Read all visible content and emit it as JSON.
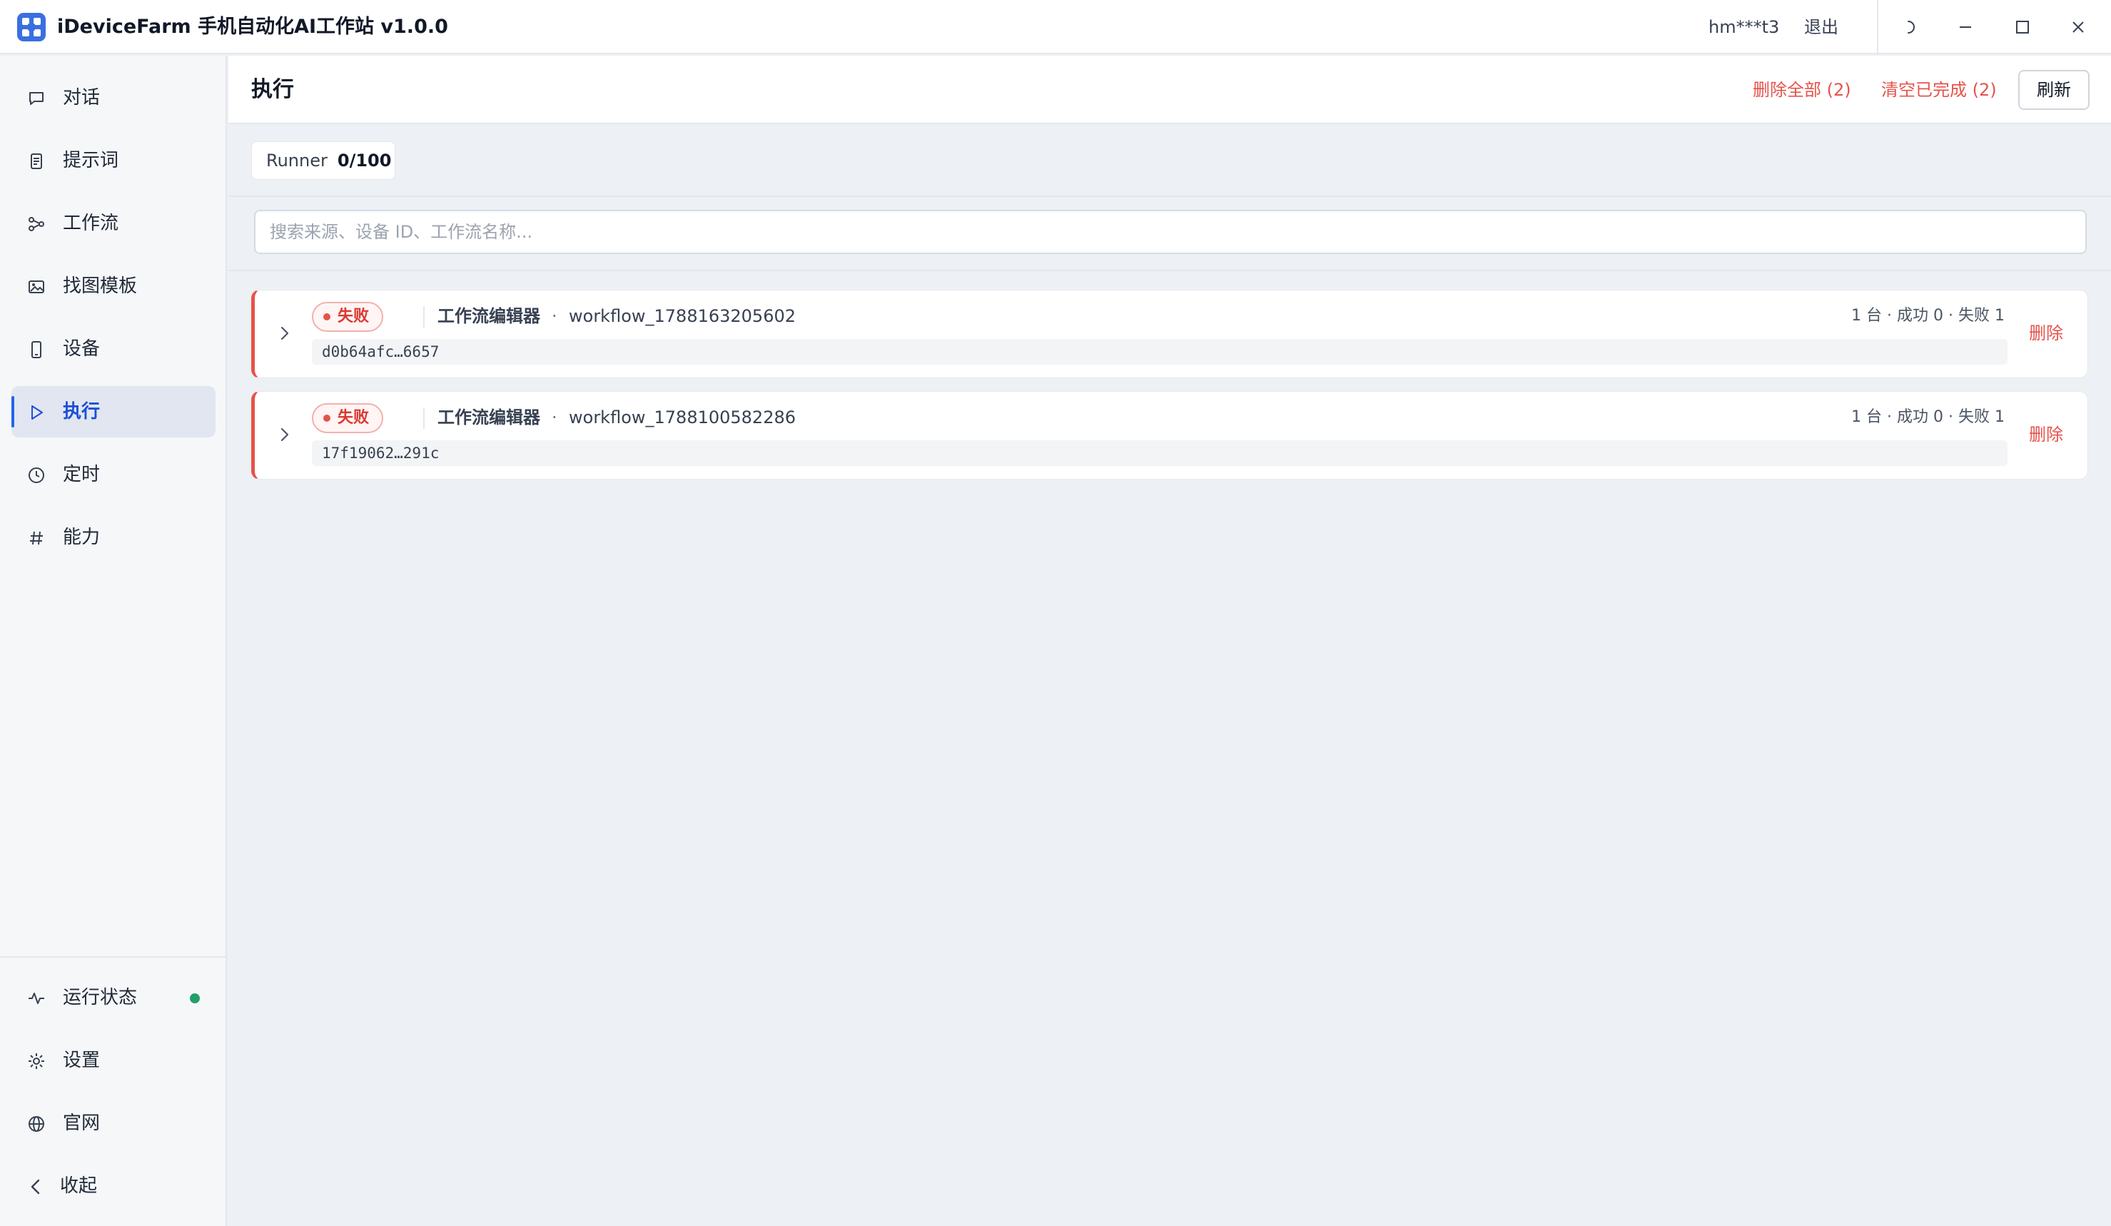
{
  "app": {
    "title": "iDeviceFarm 手机自动化AI工作站 v1.0.0",
    "user": "hm***t3",
    "logout": "退出"
  },
  "sidebar": {
    "items": [
      {
        "label": "对话",
        "icon": "chat-icon"
      },
      {
        "label": "提示词",
        "icon": "document-icon"
      },
      {
        "label": "工作流",
        "icon": "workflow-icon"
      },
      {
        "label": "找图模板",
        "icon": "image-icon"
      },
      {
        "label": "设备",
        "icon": "phone-icon"
      },
      {
        "label": "执行",
        "icon": "play-icon",
        "active": true
      },
      {
        "label": "定时",
        "icon": "clock-icon"
      },
      {
        "label": "能力",
        "icon": "hash-icon"
      }
    ],
    "bottom": [
      {
        "label": "运行状态",
        "icon": "activity-icon",
        "status_color": "#22a06b"
      },
      {
        "label": "设置",
        "icon": "gear-icon"
      },
      {
        "label": "官网",
        "icon": "globe-icon"
      },
      {
        "label": "收起",
        "icon": "chevron-left-icon"
      }
    ]
  },
  "page": {
    "title": "执行",
    "delete_all": "删除全部 (2)",
    "clear_done": "清空已完成 (2)",
    "refresh": "刷新",
    "runner_label": "Runner",
    "runner_count": "0/100",
    "search_placeholder": "搜索来源、设备 ID、工作流名称..."
  },
  "runs": [
    {
      "status": "失败",
      "source": "工作流编辑器",
      "separator": "·",
      "workflow": "workflow_1788163205602",
      "summary": "1 台 · 成功 0 · 失败 1",
      "device": "d0b64afc…6657",
      "delete": "删除"
    },
    {
      "status": "失败",
      "source": "工作流编辑器",
      "separator": "·",
      "workflow": "workflow_1788100582286",
      "summary": "1 台 · 成功 0 · 失败 1",
      "device": "17f19062…291c",
      "delete": "删除"
    }
  ],
  "colors": {
    "accent": "#2563eb",
    "danger": "#e5534b",
    "ok": "#22a06b"
  }
}
